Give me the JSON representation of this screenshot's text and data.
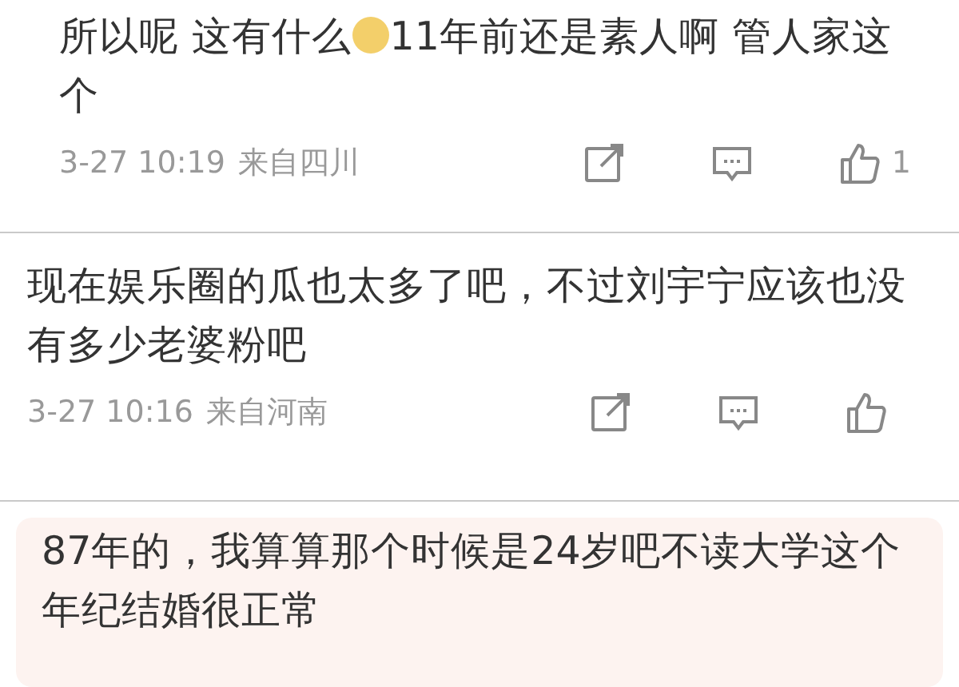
{
  "comments": [
    {
      "segments": [
        {
          "kind": "text",
          "text": "所以呢 这有什么"
        },
        {
          "kind": "emoji"
        },
        {
          "kind": "text",
          "text": "11年前还是素人啊 管人家这个"
        }
      ],
      "time": "3-27 10:19",
      "location": "来自四川",
      "likes": "1",
      "highlighted": false
    },
    {
      "segments": [
        {
          "kind": "text",
          "text": "现在娱乐圈的瓜也太多了吧，不过刘宇宁应该也没有多少老婆粉吧"
        }
      ],
      "time": "3-27 10:16",
      "location": "来自河南",
      "highlighted": false
    },
    {
      "segments": [
        {
          "kind": "text",
          "text": "87年的，我算算那个时候是24岁吧不读大学这个年纪结婚很正常"
        }
      ],
      "highlighted": true
    }
  ]
}
